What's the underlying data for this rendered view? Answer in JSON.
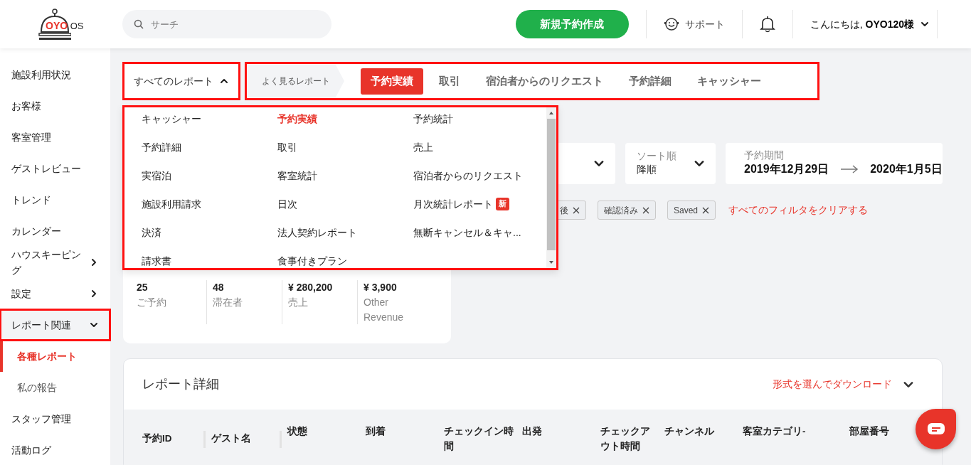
{
  "header": {
    "logo": {
      "brand": "OYO",
      "suffix": "OS"
    },
    "search": {
      "placeholder": "サーチ"
    },
    "new_booking_button": "新規予約作成",
    "support": "サポート",
    "greeting": {
      "text": "こんにちは,",
      "name": "OYO120様"
    }
  },
  "sidebar": {
    "items": [
      {
        "label": "施設利用状況",
        "kind": "link",
        "selected": false,
        "highlighted": false
      },
      {
        "label": "お客様",
        "kind": "link",
        "selected": false,
        "highlighted": false
      },
      {
        "label": "客室管理",
        "kind": "link",
        "selected": false,
        "highlighted": false
      },
      {
        "label": "ゲストレビュー",
        "kind": "link",
        "selected": false,
        "highlighted": false
      },
      {
        "label": "トレンド",
        "kind": "link",
        "selected": false,
        "highlighted": false
      },
      {
        "label": "カレンダー",
        "kind": "link",
        "selected": false,
        "highlighted": false
      },
      {
        "label": "ハウスキーピング",
        "kind": "group",
        "expanded": false,
        "selected": false,
        "highlighted": false
      },
      {
        "label": "設定",
        "kind": "group",
        "expanded": false,
        "selected": false,
        "highlighted": false
      },
      {
        "label": "レポート関連",
        "kind": "group",
        "expanded": true,
        "selected": true,
        "highlighted": true,
        "children": [
          {
            "label": "各種レポート",
            "selected": true
          },
          {
            "label": "私の報告",
            "selected": false
          }
        ]
      },
      {
        "label": "スタッフ管理",
        "kind": "link",
        "selected": false,
        "highlighted": false
      },
      {
        "label": "活動ログ",
        "kind": "link",
        "selected": false,
        "highlighted": false
      }
    ]
  },
  "report_picker": {
    "label": "すべてのレポート",
    "expanded": true,
    "highlighted": true
  },
  "frequent_reports": {
    "label": "よく見るレポート",
    "highlighted": true,
    "tabs": [
      {
        "label": "予約実績",
        "selected": true
      },
      {
        "label": "取引",
        "selected": false
      },
      {
        "label": "宿泊者からのリクエスト",
        "selected": false
      },
      {
        "label": "予約詳細",
        "selected": false
      },
      {
        "label": "キャッシャー",
        "selected": false
      }
    ]
  },
  "reports_menu": {
    "highlighted": true,
    "items": [
      {
        "label": "キャッシャー",
        "selected": false
      },
      {
        "label": "予約実績",
        "selected": true
      },
      {
        "label": "予約統計",
        "selected": false
      },
      {
        "label": "予約詳細",
        "selected": false
      },
      {
        "label": "取引",
        "selected": false
      },
      {
        "label": "売上",
        "selected": false
      },
      {
        "label": "実宿泊",
        "selected": false
      },
      {
        "label": "客室統計",
        "selected": false
      },
      {
        "label": "宿泊者からのリクエスト",
        "selected": false
      },
      {
        "label": "施設利用請求",
        "selected": false
      },
      {
        "label": "日次",
        "selected": false
      },
      {
        "label": "月次統計レポート",
        "selected": false,
        "badge": "新"
      },
      {
        "label": "決済",
        "selected": false
      },
      {
        "label": "法人契約レポート",
        "selected": false
      },
      {
        "label": "無断キャンセル＆キャ...",
        "selected": false
      },
      {
        "label": "請求書",
        "selected": false
      },
      {
        "label": "食事付きプラン",
        "selected": false
      }
    ]
  },
  "filters": {
    "selects": [
      {
        "kind": "partial"
      },
      {
        "kind": "full",
        "label": "ソート順",
        "value": "降順"
      }
    ],
    "period": {
      "label": "予約期間",
      "start": "2019年12月29日",
      "end": "2020年1月5日"
    },
    "chips": [
      "後",
      "確認済み",
      "Saved"
    ],
    "clear_filters": "すべてのフィルタをクリアする"
  },
  "summary": [
    {
      "value": "25",
      "label": "ご予約"
    },
    {
      "value": "48",
      "label": "滞在者"
    },
    {
      "value": "¥ 280,200",
      "label": "売上"
    },
    {
      "value": "¥ 3,900",
      "label": "Other Revenue"
    }
  ],
  "report_detail": {
    "title": "レポート詳細",
    "download": "形式を選んでダウンロード",
    "columns": [
      "予約ID",
      "ゲスト名",
      "状態",
      "到着",
      "チェックイン時間",
      "出発",
      "チェックアウト時間",
      "チャンネル",
      "客室カテゴリ-",
      "部屋番号"
    ]
  }
}
